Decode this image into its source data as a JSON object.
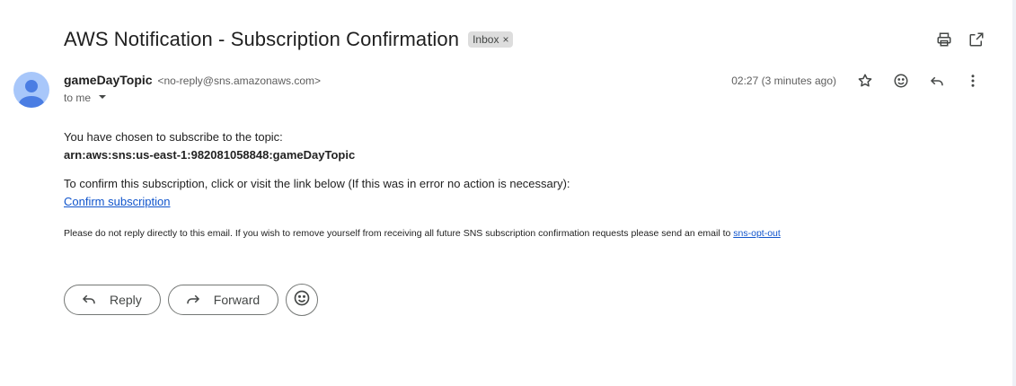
{
  "email": {
    "subject": "AWS Notification - Subscription Confirmation",
    "label": "Inbox",
    "label_remove": "×",
    "sender_name": "gameDayTopic",
    "sender_address": "<no-reply@sns.amazonaws.com>",
    "recipient": "to me",
    "timestamp": "02:27 (3 minutes ago)"
  },
  "body": {
    "line1": "You have chosen to subscribe to the topic:",
    "arn": "arn:aws:sns:us-east-1:982081058848:gameDayTopic",
    "line2": "To confirm this subscription, click or visit the link below (If this was in error no action is necessary):",
    "confirm_link": "Confirm subscription",
    "note": "Please do not reply directly to this email. If you wish to remove yourself from receiving all future SNS subscription confirmation requests please send an email to ",
    "opt_out_link": "sns-opt-out"
  },
  "actions": {
    "reply_label": "Reply",
    "forward_label": "Forward"
  },
  "icons": {
    "top": [
      "print-icon",
      "open-in-new-window-icon"
    ],
    "message": [
      "star-icon",
      "emoji-reaction-icon",
      "reply-icon",
      "more-options-icon"
    ]
  },
  "colors": {
    "link": "#1155cc",
    "avatar_bg": "#a8c7fa",
    "avatar_fg": "#4a7de3"
  }
}
